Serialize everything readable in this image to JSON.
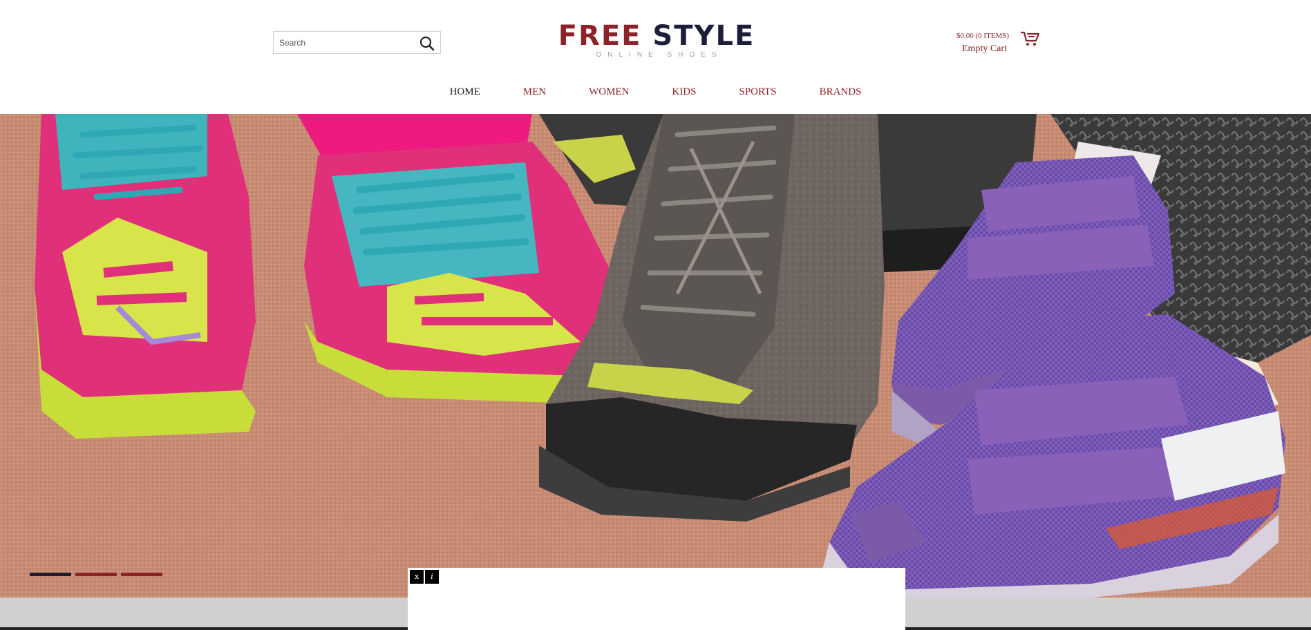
{
  "header": {
    "search": {
      "placeholder": "Search",
      "value": ""
    },
    "logo": {
      "free": "FREE",
      "style": "STYLE",
      "tagline": "ONLINE SHOES"
    },
    "cart": {
      "total": "$0.00 (0 ITEMS)",
      "status": "Empty Cart"
    }
  },
  "nav": {
    "items": [
      {
        "label": "HOME",
        "active": true
      },
      {
        "label": "MEN"
      },
      {
        "label": "WOMEN"
      },
      {
        "label": "KIDS"
      },
      {
        "label": "SPORTS"
      },
      {
        "label": "BRANDS"
      }
    ]
  },
  "hero": {
    "slide_count": 3,
    "active_slide": 1
  },
  "ad": {
    "close_label": "x",
    "info_label": "i"
  },
  "colors": {
    "brand_red": "#8c2328",
    "brand_navy": "#1b1f3a",
    "dot_active": "#1b1b2a",
    "dot_inactive": "#8c2328"
  }
}
